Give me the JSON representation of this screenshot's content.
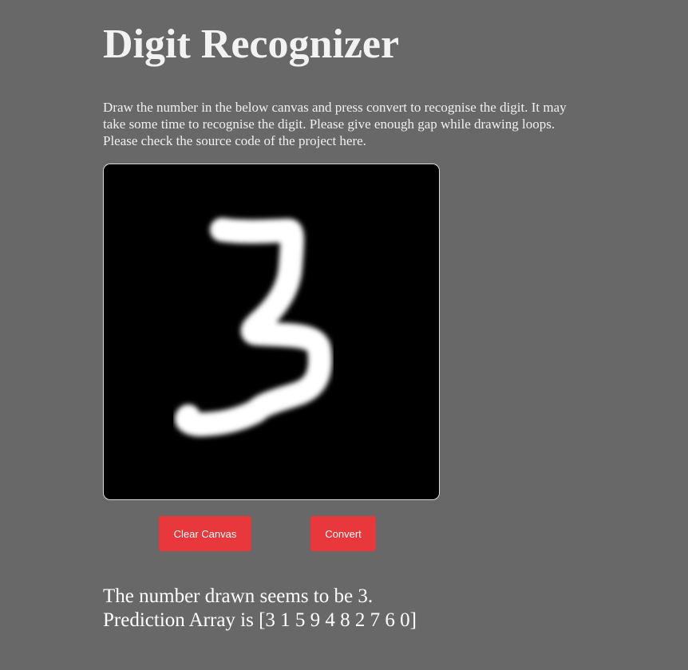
{
  "header": {
    "title": "Digit Recognizer"
  },
  "intro": {
    "line1": "Draw the number in the below canvas and press convert to recognise the digit. It may",
    "line2": "take some time to recognise the digit. Please give enough gap while drawing loops.",
    "line3": "Please check the source code of the project here."
  },
  "canvas": {
    "background_color": "#000000",
    "stroke_color": "#ffffff",
    "drawn_digit": "3"
  },
  "buttons": {
    "clear_label": "Clear Canvas",
    "convert_label": "Convert",
    "color": "#e8383b"
  },
  "result": {
    "prediction_text": "The number drawn seems to be 3.",
    "array_text": "Prediction Array is [3 1 5 9 4 8 2 7 6 0]"
  },
  "theme": {
    "page_background": "#686868"
  }
}
